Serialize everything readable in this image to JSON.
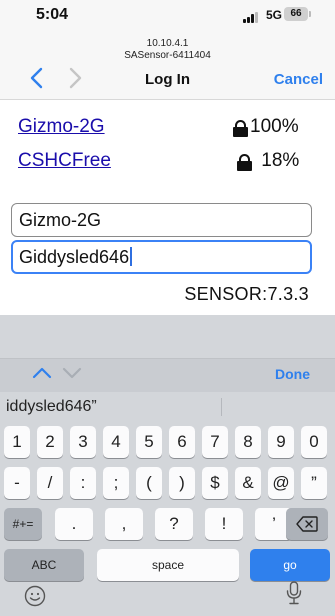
{
  "status_bar": {
    "time": "5:04",
    "network": "5G",
    "battery": "66"
  },
  "portal": {
    "ip": "10.10.4.1",
    "ssid": "SASensor-6411404",
    "title": "Log In",
    "cancel_label": "Cancel",
    "back_icon": "chevron-left-icon",
    "forward_icon": "chevron-right-icon"
  },
  "networks": [
    {
      "name": "Gizmo-2G",
      "strength": "100%"
    },
    {
      "name": "CSHCFree",
      "strength": " 18%"
    }
  ],
  "form": {
    "ssid_value": "Gizmo-2G",
    "password_value": "Giddysled646"
  },
  "version": "SENSOR:7.3.3",
  "keyboard": {
    "done_label": "Done",
    "suggestion": "iddysled646”",
    "row1": [
      "1",
      "2",
      "3",
      "4",
      "5",
      "6",
      "7",
      "8",
      "9",
      "0"
    ],
    "row2": [
      "-",
      "/",
      ":",
      ";",
      "(",
      ")",
      "$",
      "&",
      "@",
      "”"
    ],
    "row3_left": "#+=",
    "row3": [
      ".",
      ",",
      "?",
      "!",
      "’"
    ],
    "row4": {
      "abc": "ABC",
      "space": "space",
      "go": "go"
    }
  },
  "colors": {
    "accent": "#2f80ed",
    "link": "#1a0dab",
    "keyboard_bg": "#d3d6da"
  }
}
